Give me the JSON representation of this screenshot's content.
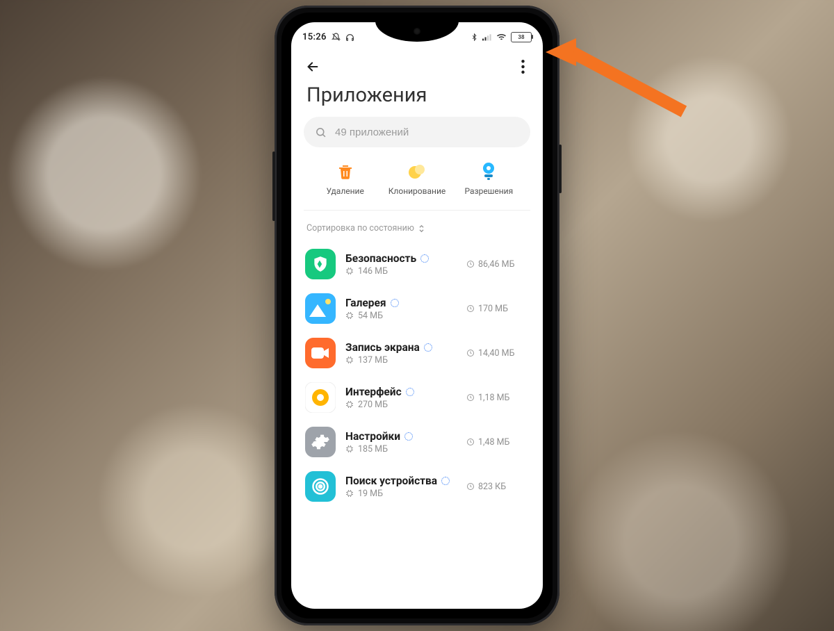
{
  "statusbar": {
    "time": "15:26",
    "battery": "38"
  },
  "header": {
    "title": "Приложения"
  },
  "search": {
    "placeholder": "49 приложений"
  },
  "quick": {
    "delete_label": "Удаление",
    "clone_label": "Клонирование",
    "perms_label": "Разрешения"
  },
  "sort": {
    "label": "Сортировка по состоянию"
  },
  "apps": [
    {
      "name": "Безопасность",
      "storage": "146 МБ",
      "clock": "86,46 МБ",
      "icon": "shield",
      "bg": "#17c97f"
    },
    {
      "name": "Галерея",
      "storage": "54 МБ",
      "clock": "170 МБ",
      "icon": "gallery",
      "bg": "#35b6ff"
    },
    {
      "name": "Запись экрана",
      "storage": "137 МБ",
      "clock": "14,40 МБ",
      "icon": "camera",
      "bg": "#ff6b2d"
    },
    {
      "name": "Интерфейс",
      "storage": "270 МБ",
      "clock": "1,18 МБ",
      "icon": "circle",
      "bg": "#ffffff"
    },
    {
      "name": "Настройки",
      "storage": "185 МБ",
      "clock": "1,48 МБ",
      "icon": "gear",
      "bg": "#9ea3aa"
    },
    {
      "name": "Поиск устройства",
      "storage": "19 МБ",
      "clock": "823 КБ",
      "icon": "target",
      "bg": "#22c0d6"
    }
  ]
}
